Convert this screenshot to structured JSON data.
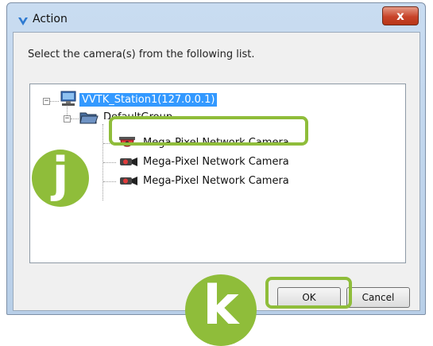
{
  "window": {
    "title": "Action",
    "close_label": "x"
  },
  "prompt": "Select the camera(s) from the following list.",
  "tree": {
    "station": "VVTK_Station1(127.0.0.1)",
    "group": "DefaultGroup",
    "cameras": [
      "Mega-Pixel Network Camera",
      "Mega-Pixel Network Camera",
      "Mega-Pixel Network Camera"
    ]
  },
  "buttons": {
    "ok": "OK",
    "cancel": "Cancel"
  },
  "markers": {
    "j": "j",
    "k": "k"
  },
  "colors": {
    "highlight": "#8fbd3a",
    "selection": "#3399ff"
  }
}
